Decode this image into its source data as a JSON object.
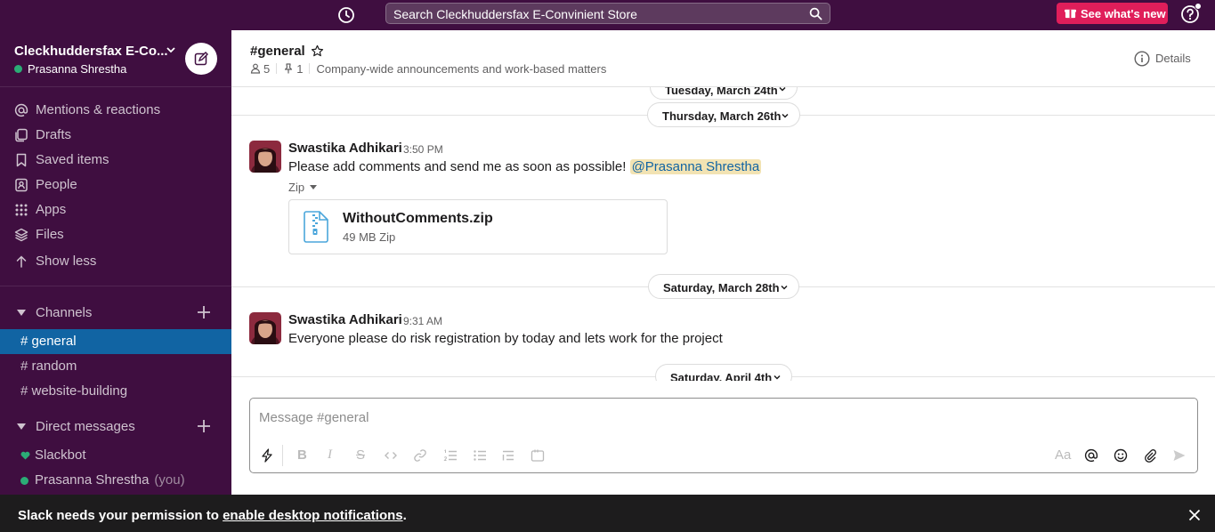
{
  "topbar": {
    "search_placeholder": "Search Cleckhuddersfax E-Convinient Store",
    "whats_new_label": "See what's new",
    "accent": "#3f0e40",
    "badge_color": "#e01e5a"
  },
  "workspace": {
    "name": "Cleckhuddersfax E-Co...",
    "user": "Prasanna Shrestha"
  },
  "sidebar": {
    "nav": [
      {
        "label": "Mentions & reactions",
        "icon": "at-icon"
      },
      {
        "label": "Drafts",
        "icon": "drafts-icon"
      },
      {
        "label": "Saved items",
        "icon": "bookmark-icon"
      },
      {
        "label": "People",
        "icon": "people-icon"
      },
      {
        "label": "Apps",
        "icon": "apps-grid-icon"
      },
      {
        "label": "Files",
        "icon": "files-stack-icon"
      },
      {
        "label": "Show less",
        "icon": "arrow-up-icon"
      }
    ],
    "channels_label": "Channels",
    "channels": [
      {
        "label": "# general",
        "active": true
      },
      {
        "label": "# random",
        "active": false
      },
      {
        "label": "# website-building",
        "active": false
      }
    ],
    "dm_label": "Direct messages",
    "dms": [
      {
        "label": "Slackbot"
      },
      {
        "label": "Prasanna Shrestha",
        "suffix": "(you)"
      }
    ],
    "active_color": "#1164a3"
  },
  "channel": {
    "title": "#general",
    "members": "5",
    "pinned": "1",
    "description": "Company-wide announcements and work-based matters",
    "details_label": "Details"
  },
  "messages": {
    "date_top_partial": "Tuesday, March 24th",
    "date_1": "Thursday, March 26th",
    "msg_1": {
      "sender": "Swastika Adhikari",
      "time": "3:50 PM",
      "text": "Please add comments and send me as soon as possible!",
      "mention": "@Prasanna Shrestha",
      "attachment_type": "Zip",
      "file_name": "WithoutComments.zip",
      "file_meta": "49 MB Zip"
    },
    "date_2": "Saturday, March 28th",
    "msg_2": {
      "sender": "Swastika Adhikari",
      "time": "9:31 AM",
      "text": "Everyone please do risk registration by today and lets work for the project"
    },
    "date_3": "Saturday, April 4th"
  },
  "composer": {
    "placeholder": "Message #general",
    "format_label": "Aa"
  },
  "banner": {
    "text": "Slack needs your permission to ",
    "link": "enable desktop notifications",
    "suffix": "."
  }
}
